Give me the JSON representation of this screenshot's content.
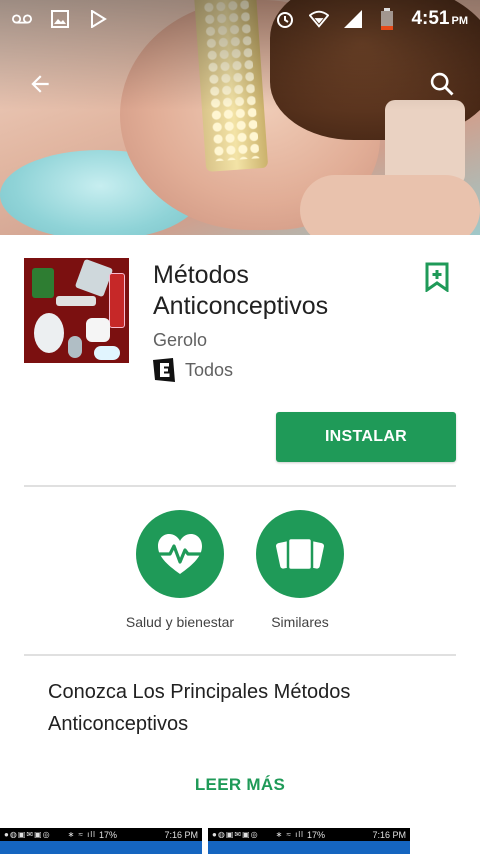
{
  "status_bar": {
    "time": "4:51",
    "ampm": "PM",
    "left_icons": [
      "voicemail-icon",
      "image-icon",
      "play-store-icon"
    ],
    "right_icons": [
      "alarm-icon",
      "wifi-icon",
      "signal-icon",
      "battery-icon"
    ]
  },
  "action_bar": {
    "back_icon": "arrow-left-icon",
    "search_icon": "search-icon"
  },
  "app": {
    "title": "Métodos Anticonceptivos",
    "developer": "Gerolo",
    "rating_text": "Todos",
    "install_label": "INSTALAR"
  },
  "chips": [
    {
      "label": "Salud y bienestar",
      "icon": "heart-pulse-icon"
    },
    {
      "label": "Similares",
      "icon": "cards-icon"
    }
  ],
  "description": {
    "text": "Conozca Los Principales Métodos Anticonceptivos",
    "read_more_label": "LEER MÁS"
  },
  "screenshots": [
    {
      "time": "7:16 PM",
      "battery": "17%"
    },
    {
      "time": "7:16 PM",
      "battery": "17%"
    }
  ],
  "colors": {
    "accent": "#1f9a58",
    "icon_bg": "#7b1010"
  }
}
